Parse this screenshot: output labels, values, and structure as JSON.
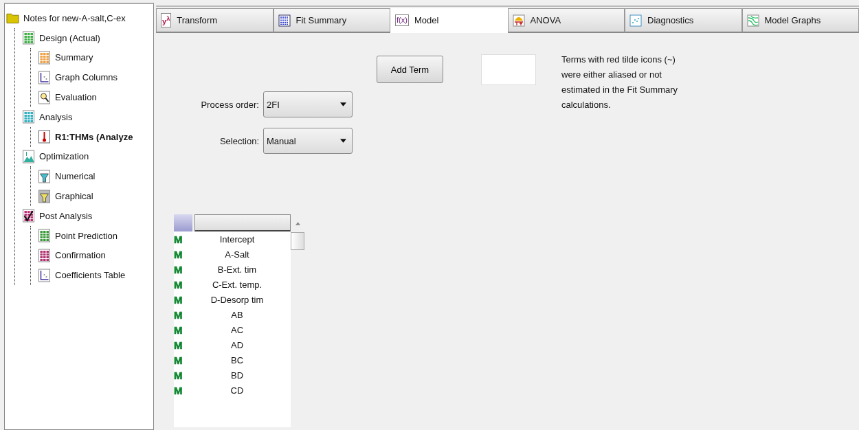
{
  "tree": {
    "label": "Notes for new-A-salt,C-ex",
    "kind": "folder",
    "selected": false,
    "children": [
      {
        "label": "Design (Actual)",
        "kind": "design",
        "selected": false,
        "children": [
          {
            "label": "Summary",
            "kind": "summary",
            "selected": false
          },
          {
            "label": "Graph Columns",
            "kind": "graph",
            "selected": false
          },
          {
            "label": "Evaluation",
            "kind": "evaluation",
            "selected": false
          }
        ]
      },
      {
        "label": "Analysis",
        "kind": "analysis",
        "selected": false,
        "children": [
          {
            "label": "R1:THMs (Analyze",
            "kind": "response",
            "selected": true
          }
        ]
      },
      {
        "label": "Optimization",
        "kind": "optimization",
        "selected": false,
        "children": [
          {
            "label": "Numerical",
            "kind": "numerical",
            "selected": false
          },
          {
            "label": "Graphical",
            "kind": "graphical",
            "selected": false
          }
        ]
      },
      {
        "label": "Post Analysis",
        "kind": "post",
        "selected": false,
        "children": [
          {
            "label": "Point Prediction",
            "kind": "point",
            "selected": false
          },
          {
            "label": "Confirmation",
            "kind": "confirmation",
            "selected": false
          },
          {
            "label": "Coefficients Table",
            "kind": "coefficients",
            "selected": false
          }
        ]
      }
    ]
  },
  "tabs": [
    {
      "label": "Transform",
      "kind": "transform",
      "icon_text": "y$^{λ}$",
      "selected": false
    },
    {
      "label": "Fit Summary",
      "kind": "fit",
      "selected": false
    },
    {
      "label": "Model",
      "kind": "model",
      "icon_text": "f(x)",
      "selected": true
    },
    {
      "label": "ANOVA",
      "kind": "anova",
      "selected": false
    },
    {
      "label": "Diagnostics",
      "kind": "diagnostics",
      "selected": false
    },
    {
      "label": "Model Graphs",
      "kind": "graphs",
      "selected": false
    }
  ],
  "add_term_button": "Add Term",
  "note": "Terms with red tilde icons (~) were either aliased or not estimated in the Fit Summary calculations.",
  "dropdowns": [
    {
      "label": "Process order:",
      "value": "2FI"
    },
    {
      "label": "Selection:",
      "value": "Manual"
    }
  ],
  "terms": [
    {
      "mark": "M",
      "label": "Intercept"
    },
    {
      "mark": "M",
      "label": "A-Salt"
    },
    {
      "mark": "M",
      "label": "B-Ext. tim"
    },
    {
      "mark": "M",
      "label": "C-Ext. temp."
    },
    {
      "mark": "M",
      "label": "D-Desorp tim"
    },
    {
      "mark": "M",
      "label": "AB"
    },
    {
      "mark": "M",
      "label": "AC"
    },
    {
      "mark": "M",
      "label": "AD"
    },
    {
      "mark": "M",
      "label": "BC"
    },
    {
      "mark": "M",
      "label": "BD"
    },
    {
      "mark": "M",
      "label": "CD"
    }
  ]
}
